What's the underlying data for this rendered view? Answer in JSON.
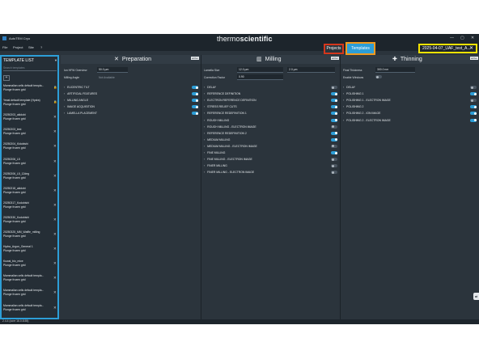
{
  "window": {
    "title": "AutoTEM Cryo",
    "brand_light": "thermo",
    "brand_bold": "scientific",
    "controls": [
      "—",
      "▢",
      "✕"
    ]
  },
  "menu": [
    "File",
    "Project",
    "Site",
    "?"
  ],
  "nav": {
    "projects_label": "Projects",
    "templates_label": "Templates",
    "session_label": "2025-04-07_UAF_test_A...",
    "session_close": "✕"
  },
  "sidebar": {
    "title": "TEMPLATE LIST",
    "search_placeholder": "Search templates",
    "add_glyph": "+",
    "items": [
      {
        "name": "Mammalian cells default templa...",
        "type": "Plunge frozen grid",
        "action": "lock"
      },
      {
        "name": "Yeast default template (Hydra)",
        "type": "Plunge frozen grid",
        "action": "lock"
      },
      {
        "name": "20250203_akidobi",
        "type": "Plunge frozen grid",
        "action": "✕"
      },
      {
        "name": "20250203_test",
        "type": "Plunge frozen grid",
        "action": "✕"
      },
      {
        "name": "20250204_Kidobishi",
        "type": "Plunge frozen grid",
        "action": "✕"
      },
      {
        "name": "20250206_L5",
        "type": "Plunge frozen grid",
        "action": "✕"
      },
      {
        "name": "20250206_L5_12deg",
        "type": "Plunge frozen grid",
        "action": "✕"
      },
      {
        "name": "20250218_akidobi",
        "type": "Plunge frozen grid",
        "action": "✕"
      },
      {
        "name": "20250317_Kodobishi",
        "type": "Plunge frozen grid",
        "action": "✕"
      },
      {
        "name": "20250330_Kodobishi",
        "type": "Plunge frozen grid",
        "action": "✕"
      },
      {
        "name": "20250325_MM_Waffle_milling",
        "type": "Plunge frozen grid",
        "action": "✕"
      },
      {
        "name": "Hydra_Argon_General 1",
        "type": "Plunge frozen grid",
        "action": "✕"
      },
      {
        "name": "Kuwai_bio_mice",
        "type": "Plunge frozen grid",
        "action": "✕"
      },
      {
        "name": "Mammalian cells default templa...",
        "type": "Plunge frozen grid",
        "action": "✕"
      },
      {
        "name": "Mammalian cells default templa...",
        "type": "Plunge frozen grid",
        "action": "✕"
      },
      {
        "name": "Mammalian cells default templa...",
        "type": "Plunge frozen grid",
        "action": "✕"
      }
    ]
  },
  "preparation": {
    "title": "Preparation",
    "icon": "crosshair-icon",
    "badge": "active",
    "fields": [
      {
        "label": "Ion HFW Overview",
        "value": "50.0 µm"
      },
      {
        "label": "Milling Angle",
        "value": "Not Available"
      }
    ],
    "rows": [
      {
        "label": "EUCENTRIC TILT",
        "on": true
      },
      {
        "label": "ARTIFICIAL FEATURES",
        "on": true
      },
      {
        "label": "MILLING ANGLE",
        "on": true
      },
      {
        "label": "IMAGE ACQUISITION",
        "on": true
      },
      {
        "label": "LAMELLA PLACEMENT",
        "on": true
      }
    ]
  },
  "milling": {
    "title": "Milling",
    "icon": "milling-icon",
    "badge": "active",
    "fields": [
      {
        "label": "Lamella Size",
        "value": "12.0 µm",
        "value2": "2.0 µm"
      },
      {
        "label": "Correction Factor",
        "value": "0.90"
      }
    ],
    "rows": [
      {
        "label": "DELAY",
        "on": false
      },
      {
        "label": "REFERENCE DEFINITION",
        "on": true
      },
      {
        "label": "ELECTRON REFERENCE DEFINITION",
        "on": true
      },
      {
        "label": "STRESS RELIEF CUTS",
        "on": true
      },
      {
        "label": "REFERENCE REDEFINITION 1",
        "on": true
      },
      {
        "label": "ROUGH MILLING",
        "on": true
      },
      {
        "label": "ROUGH MILLING - ELECTRON IMAGE",
        "on": false
      },
      {
        "label": "REFERENCE REDEFINITION 2",
        "on": true
      },
      {
        "label": "MEDIUM MILLING",
        "on": true
      },
      {
        "label": "MEDIUM MILLING - ELECTRON IMAGE",
        "on": false
      },
      {
        "label": "FINE MILLING",
        "on": true
      },
      {
        "label": "FINE MILLING - ELECTRON IMAGE",
        "on": false
      },
      {
        "label": "FINER MILLING",
        "on": false
      },
      {
        "label": "FINER MILLING - ELECTRON IMAGE",
        "on": false
      }
    ]
  },
  "thinning": {
    "title": "Thinning",
    "icon": "thinning-icon",
    "badge": "active",
    "fields": [
      {
        "label": "Final Thickness",
        "value": "300.0 nm"
      },
      {
        "label": "Enable Windows",
        "value": ""
      }
    ],
    "rows": [
      {
        "label": "DELAY",
        "on": false
      },
      {
        "label": "POLISHING 1",
        "on": true
      },
      {
        "label": "POLISHING 1 - ELECTRON IMAGE",
        "on": false
      },
      {
        "label": "POLISHING 2",
        "on": true
      },
      {
        "label": "POLISHING 2 - ION IMAGE",
        "on": true
      },
      {
        "label": "POLISHING 2 - ELECTRON IMAGE",
        "on": true
      }
    ]
  },
  "footer": {
    "version": "2.4.4 (core 16.0.8.55)"
  },
  "side_badge": "⇄",
  "colors": {
    "accent_blue": "#2d9ed7",
    "projects_outline": "#d5371c",
    "templates_outline": "#f19a1e",
    "session_outline": "#f5e200",
    "background": "#2b343c"
  }
}
